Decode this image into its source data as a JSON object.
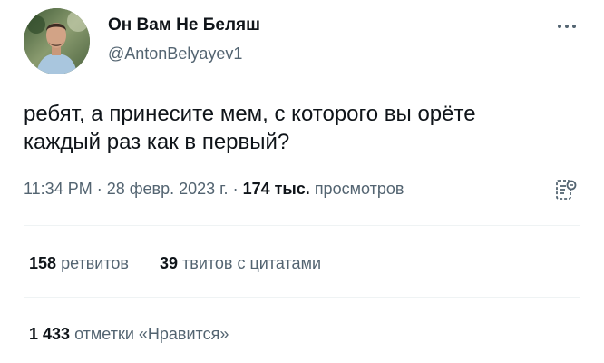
{
  "author": {
    "name": "Он Вам Не Беляш",
    "handle": "@AntonBelyayev1"
  },
  "tweet": {
    "text_line1": "ребят, а принесите мем, с которого вы орёте",
    "text_line2": "каждый раз как в первый?"
  },
  "meta": {
    "time": "11:34 PM",
    "sep1": " · ",
    "date": "28 февр. 2023 г.",
    "sep2": " · ",
    "views_count": "174 тыс.",
    "views_label": "просмотров"
  },
  "stats": {
    "retweets_count": "158",
    "retweets_label": "ретвитов",
    "quotes_count": "39",
    "quotes_label": "твитов с цитатами",
    "likes_count": "1 433",
    "likes_label": "отметки «Нравится»"
  },
  "icons": {
    "more": "more-options-icon",
    "analytics": "analytics-icon"
  },
  "colors": {
    "primary_text": "#0f1419",
    "secondary_text": "#536471",
    "divider": "#eff3f4"
  }
}
